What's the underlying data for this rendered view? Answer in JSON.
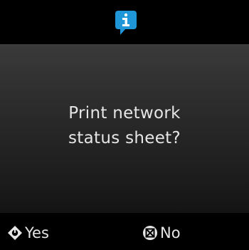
{
  "header": {
    "icon": "info-icon",
    "icon_color": "#1e96d8"
  },
  "message": {
    "line1": "Print network",
    "line2": "status sheet?"
  },
  "footer": {
    "yes": {
      "icon": "start-diamond-icon",
      "label": "Yes"
    },
    "no": {
      "icon": "stop-circle-icon",
      "label": "No"
    }
  },
  "colors": {
    "background": "#000000",
    "panel": "#2c2c2c",
    "text": "#e6e6e6"
  }
}
